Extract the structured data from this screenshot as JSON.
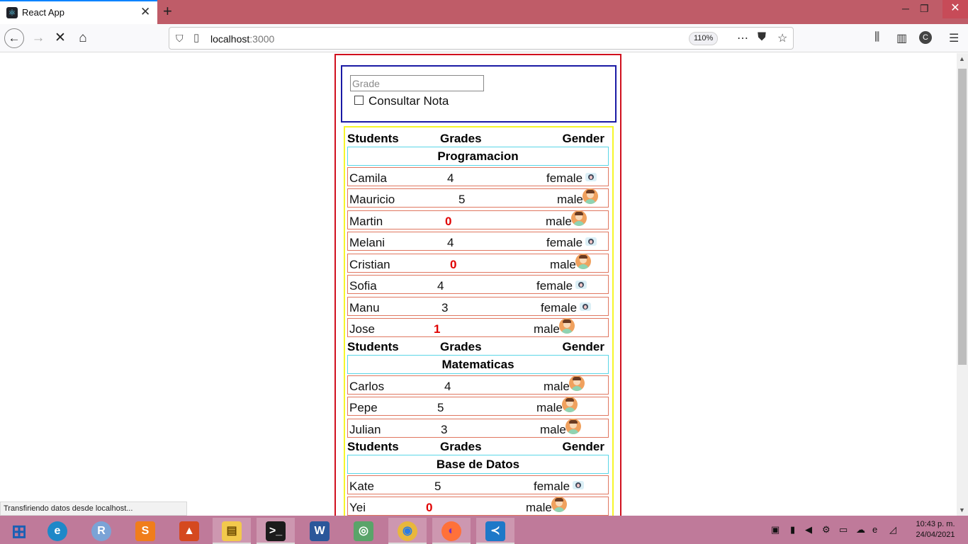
{
  "browser": {
    "tab_title": "React App",
    "tab_close": "✕",
    "new_tab": "+",
    "url_host": "localhost",
    "url_port": ":3000",
    "zoom": "110%",
    "status_text": "Transfiriendo datos desde localhost..."
  },
  "form": {
    "grade_placeholder": "Grade",
    "checkbox_label": "Consultar Nota"
  },
  "headers": {
    "students": "Students",
    "grades": "Grades",
    "gender": "Gender"
  },
  "subjects": [
    {
      "name": "Programacion",
      "students": [
        {
          "name": "Camila",
          "grade": "4",
          "gender": "female"
        },
        {
          "name": "Mauricio",
          "grade": "5",
          "gender": "male"
        },
        {
          "name": "Martin",
          "grade": "0",
          "gender": "male"
        },
        {
          "name": "Melani",
          "grade": "4",
          "gender": "female"
        },
        {
          "name": "Cristian",
          "grade": "0",
          "gender": "male"
        },
        {
          "name": "Sofia",
          "grade": "4",
          "gender": "female"
        },
        {
          "name": "Manu",
          "grade": "3",
          "gender": "female"
        },
        {
          "name": "Jose",
          "grade": "1",
          "gender": "male"
        }
      ]
    },
    {
      "name": "Matematicas",
      "students": [
        {
          "name": "Carlos",
          "grade": "4",
          "gender": "male"
        },
        {
          "name": "Pepe",
          "grade": "5",
          "gender": "male"
        },
        {
          "name": "Julian",
          "grade": "3",
          "gender": "male"
        }
      ]
    },
    {
      "name": "Base de Datos",
      "students": [
        {
          "name": "Kate",
          "grade": "5",
          "gender": "female"
        },
        {
          "name": "Yei",
          "grade": "0",
          "gender": "male"
        }
      ]
    }
  ],
  "taskbar": {
    "apps": [
      "windows-start",
      "edge",
      "r-project",
      "sublime-text",
      "matlab",
      "file-explorer",
      "terminal",
      "word",
      "maps",
      "chrome",
      "firefox",
      "vscode"
    ],
    "time": "10:43 p. m.",
    "date": "24/04/2021"
  },
  "colors": {
    "tabbar": "#bf5c68",
    "app_border": "#d0101e",
    "form_border": "#1a1aa5",
    "list_border": "#f6f62a",
    "subject_border": "#5ad6e6",
    "row_border": "#e07760",
    "fail_grade": "#e00000"
  }
}
